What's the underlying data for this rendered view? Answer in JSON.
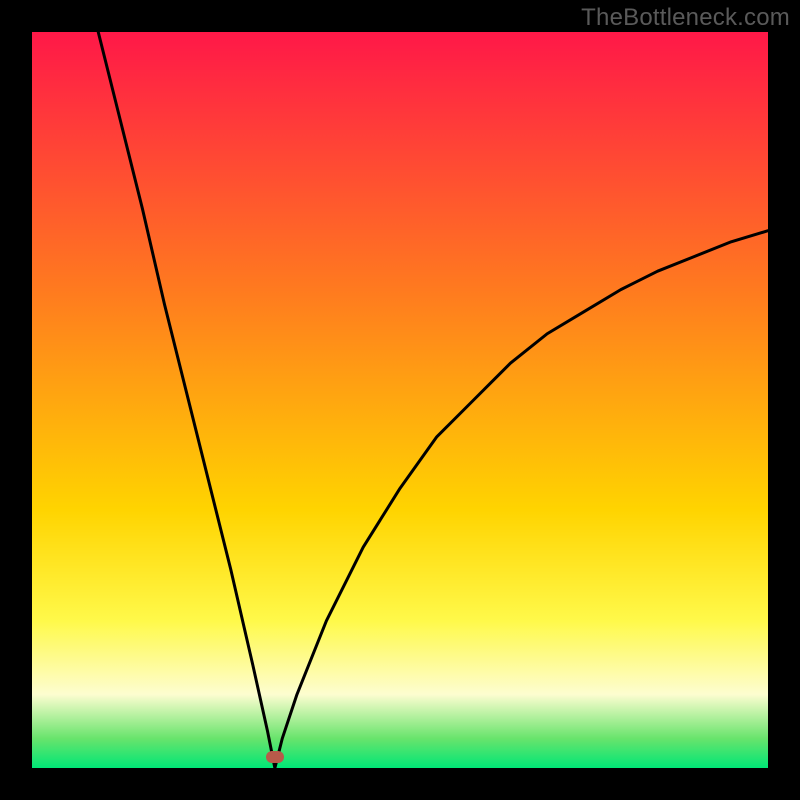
{
  "watermark": {
    "text": "TheBottleneck.com"
  },
  "colors": {
    "top": "#ff1848",
    "mid_upper": "#ff7a1f",
    "mid": "#ffd400",
    "mid_lower": "#fff94a",
    "cream": "#fdfdd0",
    "low_green": "#68e46c",
    "bottom": "#00e676",
    "curve": "#000000",
    "marker": "#b85a4a",
    "frame": "#000000"
  },
  "chart_data": {
    "type": "line",
    "title": "",
    "xlabel": "",
    "ylabel": "",
    "xlim": [
      0,
      100
    ],
    "ylim": [
      0,
      100
    ],
    "grid": false,
    "legend": false,
    "notch": {
      "x": 33,
      "y": 0
    },
    "left_start": {
      "x": 9,
      "y": 100
    },
    "right_end": {
      "x": 100,
      "y": 73
    },
    "marker": {
      "x": 33,
      "y": 1.5
    },
    "series": [
      {
        "name": "bottleneck-curve",
        "x": [
          9,
          12,
          15,
          18,
          21,
          24,
          27,
          30,
          32,
          33,
          34,
          36,
          40,
          45,
          50,
          55,
          60,
          65,
          70,
          75,
          80,
          85,
          90,
          95,
          100
        ],
        "values": [
          100,
          88,
          76,
          63,
          51,
          39,
          27,
          14,
          5,
          0,
          4,
          10,
          20,
          30,
          38,
          45,
          50,
          55,
          59,
          62,
          65,
          67.5,
          69.5,
          71.5,
          73
        ]
      }
    ],
    "gradient_bands_pct_from_top": [
      {
        "color": "top",
        "at": 0
      },
      {
        "color": "mid_upper",
        "at": 35
      },
      {
        "color": "mid",
        "at": 65
      },
      {
        "color": "mid_lower",
        "at": 80
      },
      {
        "color": "cream",
        "at": 90
      },
      {
        "color": "low_green",
        "at": 96
      },
      {
        "color": "bottom",
        "at": 100
      }
    ]
  }
}
